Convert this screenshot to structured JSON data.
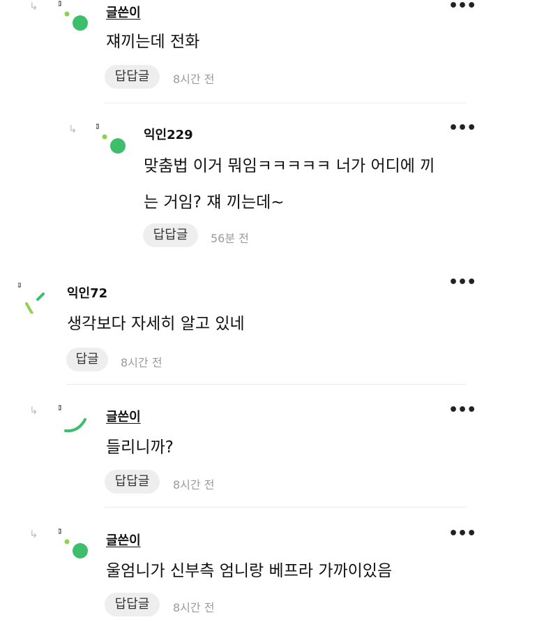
{
  "colors": {
    "avatar_green": "#3dbe6b",
    "avatar_light": "#8fd14f",
    "divider": "#ebebeb",
    "button_bg": "#eeeeee",
    "time_text": "#9a9a9a"
  },
  "comments": [
    {
      "author": "글쓴이",
      "text": "쟤끼는데 전화",
      "reply_label": "답답글",
      "time": "8시간 전",
      "more_icon": "more-dots-icon",
      "avatar_icon": "avatar-dot-icon"
    },
    {
      "author": "익인229",
      "text_line1": "맞춤법 이거 뭐임ㅋㅋㅋㅋㅋ 너가 어디에 끼",
      "text_line2": "는 거임? 쟤 끼는데~",
      "reply_label": "답답글",
      "time": "56분 전",
      "more_icon": "more-dots-icon",
      "avatar_icon": "avatar-dot-icon"
    },
    {
      "author": "익인72",
      "text": "생각보다 자세히 알고 있네",
      "reply_label": "답글",
      "time": "8시간 전",
      "more_icon": "more-dots-icon",
      "avatar_icon": "avatar-slash-icon"
    },
    {
      "author": "글쓴이",
      "text": "들리니까?",
      "reply_label": "답답글",
      "time": "8시간 전",
      "more_icon": "more-dots-icon",
      "avatar_icon": "avatar-arc-icon"
    },
    {
      "author": "글쓴이",
      "text": "울엄니가 신부측 엄니랑 베프라 가까이있음",
      "reply_label": "답답글",
      "time": "8시간 전",
      "more_icon": "more-dots-icon",
      "avatar_icon": "avatar-dot-icon"
    }
  ]
}
